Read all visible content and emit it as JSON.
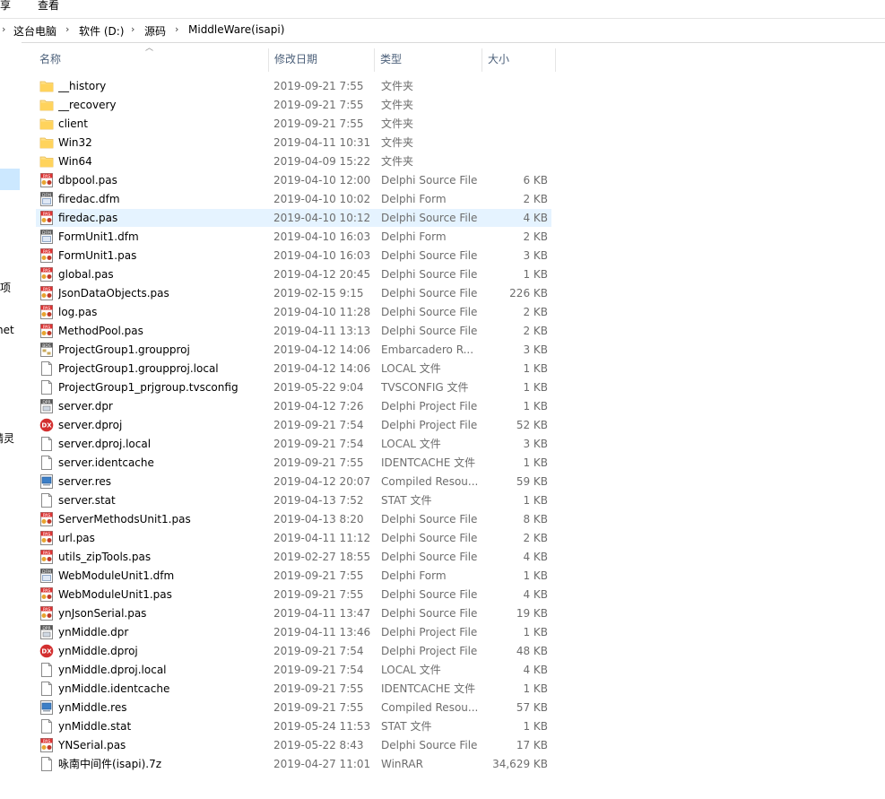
{
  "menu": [
    "享",
    "查看"
  ],
  "breadcrumb": [
    "这台电脑",
    "软件 (D:)",
    "源码",
    "MiddleWare(isapi)"
  ],
  "nav_fragments": [
    "项",
    "net",
    "精灵"
  ],
  "columns": {
    "name": "名称",
    "date": "修改日期",
    "type": "类型",
    "size": "大小"
  },
  "selected_row": 7,
  "files": [
    {
      "name": "__history",
      "date": "2019-09-21 7:55",
      "type": "文件夹",
      "size": "",
      "icon": "folder-icon"
    },
    {
      "name": "__recovery",
      "date": "2019-09-21 7:55",
      "type": "文件夹",
      "size": "",
      "icon": "folder-icon"
    },
    {
      "name": "client",
      "date": "2019-09-21 7:55",
      "type": "文件夹",
      "size": "",
      "icon": "folder-icon"
    },
    {
      "name": "Win32",
      "date": "2019-04-11 10:31",
      "type": "文件夹",
      "size": "",
      "icon": "folder-icon"
    },
    {
      "name": "Win64",
      "date": "2019-04-09 15:22",
      "type": "文件夹",
      "size": "",
      "icon": "folder-icon"
    },
    {
      "name": "dbpool.pas",
      "date": "2019-04-10 12:00",
      "type": "Delphi Source File",
      "size": "6 KB",
      "icon": "pas-file-icon"
    },
    {
      "name": "firedac.dfm",
      "date": "2019-04-10 10:02",
      "type": "Delphi Form",
      "size": "2 KB",
      "icon": "dfm-file-icon"
    },
    {
      "name": "firedac.pas",
      "date": "2019-04-10 10:12",
      "type": "Delphi Source File",
      "size": "4 KB",
      "icon": "pas-file-icon"
    },
    {
      "name": "FormUnit1.dfm",
      "date": "2019-04-10 16:03",
      "type": "Delphi Form",
      "size": "2 KB",
      "icon": "dfm-file-icon"
    },
    {
      "name": "FormUnit1.pas",
      "date": "2019-04-10 16:03",
      "type": "Delphi Source File",
      "size": "3 KB",
      "icon": "pas-file-icon"
    },
    {
      "name": "global.pas",
      "date": "2019-04-12 20:45",
      "type": "Delphi Source File",
      "size": "1 KB",
      "icon": "pas-file-icon"
    },
    {
      "name": "JsonDataObjects.pas",
      "date": "2019-02-15 9:15",
      "type": "Delphi Source File",
      "size": "226 KB",
      "icon": "pas-file-icon"
    },
    {
      "name": "log.pas",
      "date": "2019-04-10 11:28",
      "type": "Delphi Source File",
      "size": "2 KB",
      "icon": "pas-file-icon"
    },
    {
      "name": "MethodPool.pas",
      "date": "2019-04-11 13:13",
      "type": "Delphi Source File",
      "size": "2 KB",
      "icon": "pas-file-icon"
    },
    {
      "name": "ProjectGroup1.groupproj",
      "date": "2019-04-12 14:06",
      "type": "Embarcadero R...",
      "size": "3 KB",
      "icon": "groupproj-file-icon"
    },
    {
      "name": "ProjectGroup1.groupproj.local",
      "date": "2019-04-12 14:06",
      "type": "LOCAL 文件",
      "size": "1 KB",
      "icon": "blank-file-icon"
    },
    {
      "name": "ProjectGroup1_prjgroup.tvsconfig",
      "date": "2019-05-22 9:04",
      "type": "TVSCONFIG 文件",
      "size": "1 KB",
      "icon": "blank-file-icon"
    },
    {
      "name": "server.dpr",
      "date": "2019-04-12 7:26",
      "type": "Delphi Project File",
      "size": "1 KB",
      "icon": "dpr-file-icon"
    },
    {
      "name": "server.dproj",
      "date": "2019-09-21 7:54",
      "type": "Delphi Project File",
      "size": "52 KB",
      "icon": "dproj-file-icon"
    },
    {
      "name": "server.dproj.local",
      "date": "2019-09-21 7:54",
      "type": "LOCAL 文件",
      "size": "3 KB",
      "icon": "blank-file-icon"
    },
    {
      "name": "server.identcache",
      "date": "2019-09-21 7:55",
      "type": "IDENTCACHE 文件",
      "size": "1 KB",
      "icon": "blank-file-icon"
    },
    {
      "name": "server.res",
      "date": "2019-04-12 20:07",
      "type": "Compiled Resou...",
      "size": "59 KB",
      "icon": "res-file-icon"
    },
    {
      "name": "server.stat",
      "date": "2019-04-13 7:52",
      "type": "STAT 文件",
      "size": "1 KB",
      "icon": "blank-file-icon"
    },
    {
      "name": "ServerMethodsUnit1.pas",
      "date": "2019-04-13 8:20",
      "type": "Delphi Source File",
      "size": "8 KB",
      "icon": "pas-file-icon"
    },
    {
      "name": "url.pas",
      "date": "2019-04-11 11:12",
      "type": "Delphi Source File",
      "size": "2 KB",
      "icon": "pas-file-icon"
    },
    {
      "name": "utils_zipTools.pas",
      "date": "2019-02-27 18:55",
      "type": "Delphi Source File",
      "size": "4 KB",
      "icon": "pas-file-icon"
    },
    {
      "name": "WebModuleUnit1.dfm",
      "date": "2019-09-21 7:55",
      "type": "Delphi Form",
      "size": "1 KB",
      "icon": "dfm-file-icon"
    },
    {
      "name": "WebModuleUnit1.pas",
      "date": "2019-09-21 7:55",
      "type": "Delphi Source File",
      "size": "4 KB",
      "icon": "pas-file-icon"
    },
    {
      "name": "ynJsonSerial.pas",
      "date": "2019-04-11 13:47",
      "type": "Delphi Source File",
      "size": "19 KB",
      "icon": "pas-file-icon"
    },
    {
      "name": "ynMiddle.dpr",
      "date": "2019-04-11 13:46",
      "type": "Delphi Project File",
      "size": "1 KB",
      "icon": "dpr-file-icon"
    },
    {
      "name": "ynMiddle.dproj",
      "date": "2019-09-21 7:54",
      "type": "Delphi Project File",
      "size": "48 KB",
      "icon": "dproj-file-icon"
    },
    {
      "name": "ynMiddle.dproj.local",
      "date": "2019-09-21 7:54",
      "type": "LOCAL 文件",
      "size": "4 KB",
      "icon": "blank-file-icon"
    },
    {
      "name": "ynMiddle.identcache",
      "date": "2019-09-21 7:55",
      "type": "IDENTCACHE 文件",
      "size": "1 KB",
      "icon": "blank-file-icon"
    },
    {
      "name": "ynMiddle.res",
      "date": "2019-09-21 7:55",
      "type": "Compiled Resou...",
      "size": "57 KB",
      "icon": "res-file-icon"
    },
    {
      "name": "ynMiddle.stat",
      "date": "2019-05-24 11:53",
      "type": "STAT 文件",
      "size": "1 KB",
      "icon": "blank-file-icon"
    },
    {
      "name": "YNSerial.pas",
      "date": "2019-05-22 8:43",
      "type": "Delphi Source File",
      "size": "17 KB",
      "icon": "pas-file-icon"
    },
    {
      "name": "咏南中间件(isapi).7z",
      "date": "2019-04-27 11:01",
      "type": "WinRAR",
      "size": "34,629 KB",
      "icon": "blank-file-icon"
    }
  ]
}
